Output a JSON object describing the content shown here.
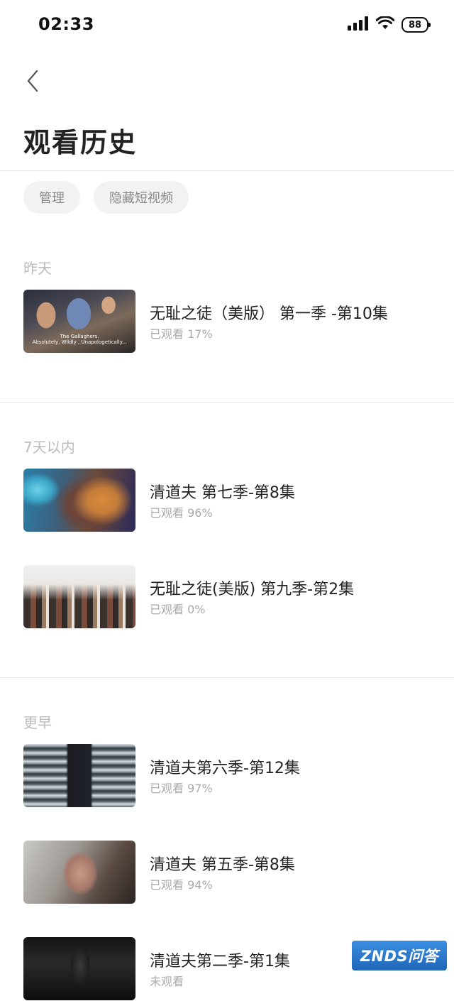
{
  "status_bar": {
    "time": "02:33",
    "battery": "88"
  },
  "header": {
    "title": "观看历史"
  },
  "chips": {
    "manage": "管理",
    "hide_short": "隐藏短视频"
  },
  "sections": [
    {
      "label": "昨天",
      "items": [
        {
          "title": "无耻之徒（美版） 第一季 -第10集",
          "progress": "已观看 17%",
          "thumb_caption_1": "The Gallaghers.",
          "thumb_caption_2": "Absolutely, Wildly , Unapologetically..."
        }
      ]
    },
    {
      "label": "7天以内",
      "items": [
        {
          "title": "清道夫 第七季-第8集",
          "progress": "已观看 96%"
        },
        {
          "title": "无耻之徒(美版) 第九季-第2集",
          "progress": "已观看 0%"
        }
      ]
    },
    {
      "label": "更早",
      "items": [
        {
          "title": "清道夫第六季-第12集",
          "progress": "已观看 97%"
        },
        {
          "title": "清道夫 第五季-第8集",
          "progress": "已观看 94%"
        },
        {
          "title": "清道夫第二季-第1集",
          "progress": "未观看"
        }
      ]
    }
  ],
  "watermark": {
    "text": "ZNDS问答"
  },
  "colors": {
    "divider": "#e5e5e5",
    "chip_bg": "#f2f2f2",
    "section_label": "#bbbbbb",
    "progress_text": "#aaaaaa",
    "watermark_bg": "#2f7ccf"
  }
}
